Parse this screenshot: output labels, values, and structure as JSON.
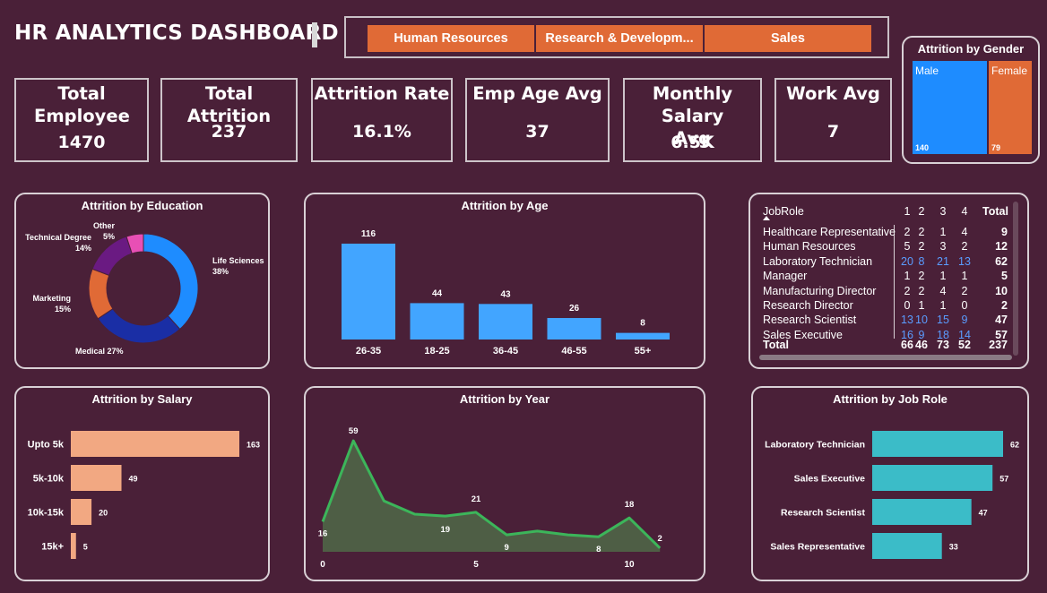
{
  "title": "HR ANALYTICS DASHBOARD",
  "departments": [
    "Human Resources",
    "Research & Developm...",
    "Sales"
  ],
  "kpis": {
    "total_employee": {
      "label": "Total Employee",
      "value": "1470"
    },
    "total_attrition": {
      "label": "Total Attrition",
      "value": "237"
    },
    "attrition_rate": {
      "label": "Attrition Rate",
      "value": "16.1%"
    },
    "emp_age_avg": {
      "label": "Emp Age Avg",
      "value": "37"
    },
    "monthly_salary_avg": {
      "label": "Monthly Salary Avg",
      "value": "6.5K"
    },
    "work_avg": {
      "label": "Work Avg",
      "value": "7"
    }
  },
  "job_role_table": {
    "columns": [
      "JobRole",
      "1",
      "2",
      "3",
      "4",
      "Total"
    ],
    "rows": [
      {
        "role": "Healthcare Representative",
        "v": [
          2,
          2,
          1,
          4
        ],
        "total": 9
      },
      {
        "role": "Human Resources",
        "v": [
          5,
          2,
          3,
          2
        ],
        "total": 12
      },
      {
        "role": "Laboratory Technician",
        "v": [
          20,
          8,
          21,
          13
        ],
        "total": 62,
        "highlight": true
      },
      {
        "role": "Manager",
        "v": [
          1,
          2,
          1,
          1
        ],
        "total": 5
      },
      {
        "role": "Manufacturing Director",
        "v": [
          2,
          2,
          4,
          2
        ],
        "total": 10
      },
      {
        "role": "Research Director",
        "v": [
          0,
          1,
          1,
          0
        ],
        "total": 2
      },
      {
        "role": "Research Scientist",
        "v": [
          13,
          10,
          15,
          9
        ],
        "total": 47,
        "highlight": true
      },
      {
        "role": "Sales Executive",
        "v": [
          16,
          9,
          18,
          14
        ],
        "total": 57,
        "highlight": true
      }
    ],
    "total_row": {
      "label": "Total",
      "v": [
        66,
        46,
        73,
        52
      ],
      "total": 237
    }
  },
  "colors": {
    "background": "#4a2038",
    "slicer": "#e06a36",
    "male": "#1e8cff",
    "female": "#e06a36",
    "age_bar": "#42a5ff",
    "salary_bar": "#f2a882",
    "jobrole_bar": "#3bbcc8",
    "line": "#3cb55a",
    "area": "#4e5e45",
    "highlight_num": "#5a9cff"
  },
  "chart_data": [
    {
      "id": "gender",
      "type": "treemap",
      "title": "Attrition by Gender",
      "categories": [
        "Male",
        "Female"
      ],
      "values": [
        140,
        79
      ]
    },
    {
      "id": "education",
      "type": "pie",
      "title": "Attrition by Education",
      "categories": [
        "Life Sciences",
        "Medical",
        "Marketing",
        "Technical Degree",
        "Other"
      ],
      "values": [
        38,
        27,
        15,
        14,
        5
      ],
      "labels": [
        "38%",
        "27%",
        "15%",
        "14%",
        "5%"
      ],
      "colors": [
        "#1e8cff",
        "#1a2ea5",
        "#e06a36",
        "#6a1a82",
        "#e84fb5"
      ]
    },
    {
      "id": "age",
      "type": "bar",
      "title": "Attrition by Age",
      "categories": [
        "26-35",
        "18-25",
        "36-45",
        "46-55",
        "55+"
      ],
      "values": [
        116,
        44,
        43,
        26,
        8
      ]
    },
    {
      "id": "salary",
      "type": "bar",
      "orientation": "horizontal",
      "title": "Attrition by Salary",
      "categories": [
        "Upto 5k",
        "5k-10k",
        "10k-15k",
        "15k+"
      ],
      "values": [
        163,
        49,
        20,
        5
      ]
    },
    {
      "id": "year",
      "type": "area",
      "title": "Attrition by Year",
      "x": [
        0,
        1,
        2,
        3,
        4,
        5,
        6,
        7,
        8,
        9,
        10,
        11
      ],
      "values": [
        16,
        59,
        27,
        20,
        19,
        21,
        9,
        11,
        9,
        8,
        18,
        2
      ],
      "point_labels": {
        "0": "16",
        "1": "59",
        "4": "19",
        "5": "21",
        "6": "9",
        "9": "8",
        "10": "18",
        "11": "2"
      },
      "xticks": [
        0,
        5,
        10
      ]
    },
    {
      "id": "jobrole",
      "type": "bar",
      "orientation": "horizontal",
      "title": "Attrition by Job Role",
      "categories": [
        "Laboratory Technician",
        "Sales Executive",
        "Research Scientist",
        "Sales Representative"
      ],
      "values": [
        62,
        57,
        47,
        33
      ]
    }
  ]
}
